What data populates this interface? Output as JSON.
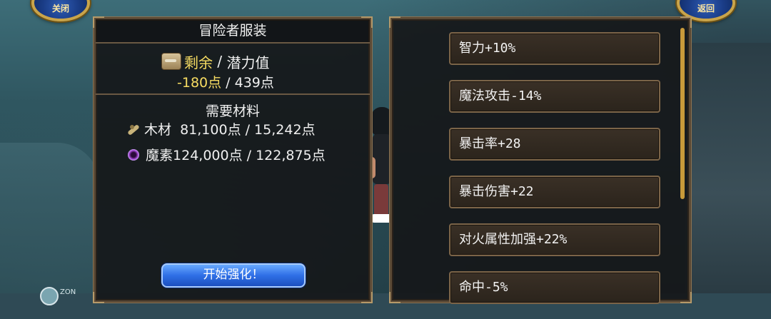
{
  "top_buttons": {
    "close_label": "关闭",
    "back_label": "返回"
  },
  "left_panel": {
    "title": "冒险者服装",
    "potential": {
      "remaining_label": "剩余",
      "separator": " / ",
      "potential_label": "潜力值",
      "remaining_value": "-180点",
      "potential_value": "439点"
    },
    "materials": {
      "title": "需要材料",
      "items": [
        {
          "name": "木材",
          "text": "  81,100点 / 15,242点"
        },
        {
          "name": "魔素",
          "text": "124,000点 / 122,875点"
        }
      ]
    },
    "start_button": "开始强化！"
  },
  "bonuses": [
    "智力+10%",
    "魔法攻击-14%",
    "暴击率+28",
    "暴击伤害+22",
    "对火属性加强+22%",
    "命中-5%"
  ],
  "bottom_hint": "ZON"
}
